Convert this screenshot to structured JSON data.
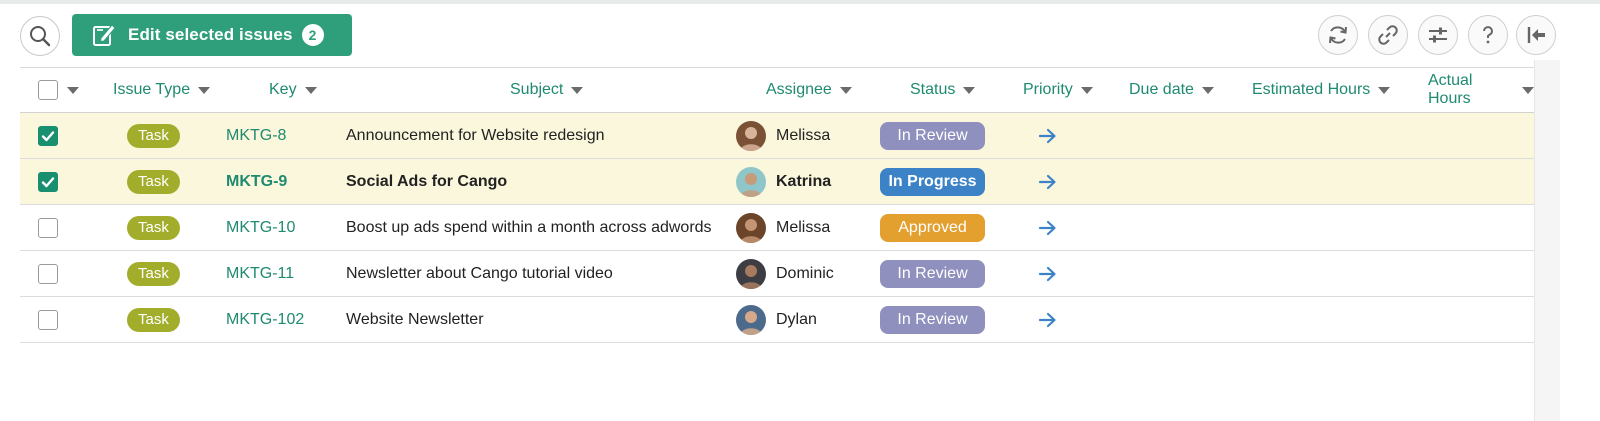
{
  "toolbar": {
    "edit_label": "Edit selected issues",
    "edit_count": "2",
    "tools": [
      "refresh-icon",
      "link-icon",
      "sliders-icon",
      "help-icon",
      "collapse-icon"
    ]
  },
  "table": {
    "headers": {
      "issue_type": "Issue Type",
      "key": "Key",
      "subject": "Subject",
      "assignee": "Assignee",
      "status": "Status",
      "priority": "Priority",
      "due_date": "Due date",
      "estimated_hours": "Estimated Hours",
      "actual_hours": "Actual Hours"
    },
    "rows": [
      {
        "checked": true,
        "type": "Task",
        "key": "MKTG-8",
        "subject": "Announcement for Website redesign",
        "assignee": "Melissa",
        "status": "In Review",
        "status_color": "#8f90bd",
        "priority": "arrow-right-icon",
        "bold": false
      },
      {
        "checked": true,
        "type": "Task",
        "key": "MKTG-9",
        "subject": "Social Ads for Cango",
        "assignee": "Katrina",
        "status": "In Progress",
        "status_color": "#3b82c6",
        "priority": "arrow-right-icon",
        "bold": true
      },
      {
        "checked": false,
        "type": "Task",
        "key": "MKTG-10",
        "subject": "Boost up ads spend within a month across adwords",
        "assignee": "Melissa",
        "status": "Approved",
        "status_color": "#e3a02f",
        "priority": "arrow-right-icon",
        "bold": false
      },
      {
        "checked": false,
        "type": "Task",
        "key": "MKTG-11",
        "subject": "Newsletter about Cango tutorial video",
        "assignee": "Dominic",
        "status": "In Review",
        "status_color": "#8f90bd",
        "priority": "arrow-right-icon",
        "bold": false
      },
      {
        "checked": false,
        "type": "Task",
        "key": "MKTG-102",
        "subject": "Website Newsletter",
        "assignee": "Dylan",
        "status": "In Review",
        "status_color": "#8f90bd",
        "priority": "arrow-right-icon",
        "bold": false
      }
    ]
  },
  "colors": {
    "accent": "#2f9f7b",
    "link": "#1f8a70",
    "selected_row": "#fbf7dc",
    "task_pill": "#a1ad2b"
  }
}
